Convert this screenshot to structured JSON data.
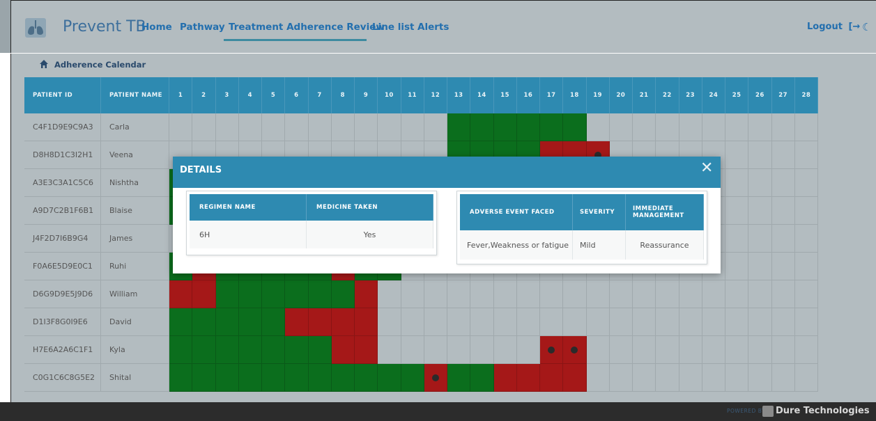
{
  "header": {
    "app_title": "Prevent TB",
    "nav": [
      "Home",
      "Pathway",
      "Treatment Adherence Review",
      "Line list",
      "Alerts"
    ],
    "active_nav": "Treatment Adherence Review",
    "logout_label": "Logout",
    "logout_icon": "logout-icon",
    "theme_icon": "moon-icon",
    "logo_icon": "lungs-logo"
  },
  "breadcrumb": {
    "label": "Adherence Calendar",
    "icon": "home-icon"
  },
  "calendar": {
    "columns": {
      "patient_id": "PATIENT ID",
      "patient_name": "PATIENT NAME",
      "days": [
        "1",
        "2",
        "3",
        "4",
        "5",
        "6",
        "7",
        "8",
        "9",
        "10",
        "11",
        "12",
        "13",
        "14",
        "15",
        "16",
        "17",
        "18",
        "19",
        "20",
        "21",
        "22",
        "23",
        "24",
        "25",
        "26",
        "27",
        "28"
      ]
    },
    "legend_colors": {
      "taken": "#0b6e1d",
      "missed": "#a51818",
      "adverse_event_dot": "#2b2b2b"
    },
    "rows": [
      {
        "patient_id": "C4F1D9E9C9A3",
        "patient_name": "Carla",
        "days": "............GGGGGG.........",
        "dots": []
      },
      {
        "patient_id": "D8H8D1C3I2H1",
        "patient_name": "Veena",
        "days": "............GGGGRRR........",
        "dots": [
          19
        ]
      },
      {
        "patient_id": "A3E3C3A1C5C6",
        "patient_name": "Nishtha",
        "days": "G..........................",
        "dots": []
      },
      {
        "patient_id": "A9D7C2B1F6B1",
        "patient_name": "Blaise",
        "days": "G..........................",
        "dots": []
      },
      {
        "patient_id": "J4F2D7I6B9G4",
        "patient_name": "James",
        "days": "...........................",
        "dots": []
      },
      {
        "patient_id": "F0A6E5D9E0C1",
        "patient_name": "Ruhi",
        "days": "GRGGGGGRGG.................",
        "dots": []
      },
      {
        "patient_id": "D6G9D9E5J9D6",
        "patient_name": "William",
        "days": "RRGGGGGGR..................",
        "dots": []
      },
      {
        "patient_id": "D1I3F8G0I9E6",
        "patient_name": "David",
        "days": "GGGGGRRRR..................",
        "dots": []
      },
      {
        "patient_id": "H7E6A2A6C1F1",
        "patient_name": "Kyla",
        "days": "GGGGGGGRR.......RR.........",
        "dots": [
          17,
          18
        ]
      },
      {
        "patient_id": "C0G1C6C8G5E2",
        "patient_name": "Shital",
        "days": "GGGGGGGGGGGRGGRRRR.........",
        "dots": [
          12
        ]
      }
    ]
  },
  "modal": {
    "title": "DETAILS",
    "close_icon": "close-icon",
    "regimen_table": {
      "headers": [
        "REGIMEN NAME",
        "MEDICINE TAKEN"
      ],
      "rows": [
        [
          "6H",
          "Yes"
        ]
      ]
    },
    "adverse_table": {
      "headers": [
        "ADVERSE EVENT FACED",
        "SEVERITY",
        "IMMEDIATE MANAGEMENT"
      ],
      "rows": [
        [
          "Fever,Weakness or fatigue",
          "Mild",
          "Reassurance"
        ]
      ]
    }
  },
  "footer": {
    "powered_by": "POWERED BY",
    "company": "Dure Technologies",
    "logo_icon": "dure-logo-icon"
  }
}
